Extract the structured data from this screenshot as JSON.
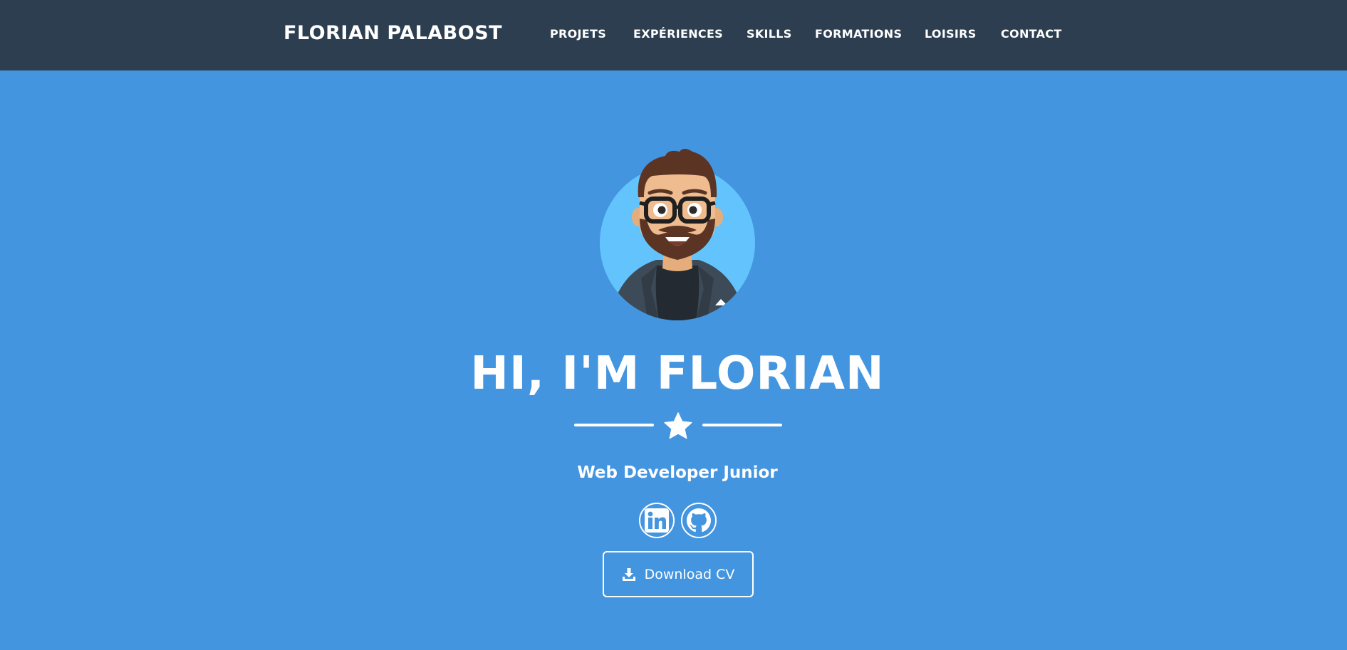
{
  "navbar": {
    "brand": "FLORIAN PALABOST",
    "items": [
      {
        "label": "PROJETS"
      },
      {
        "label": "EXPÉRIENCES"
      },
      {
        "label": "SKILLS"
      },
      {
        "label": "FORMATIONS"
      },
      {
        "label": "LOISIRS"
      },
      {
        "label": "CONTACT"
      }
    ]
  },
  "hero": {
    "avatar_icon": "bearded-man-with-glasses-avatar",
    "title": "HI, I'M FLORIAN",
    "divider_icon": "star-icon",
    "subtitle": "Web Developer Junior",
    "social": [
      {
        "icon": "linkedin-icon"
      },
      {
        "icon": "github-icon"
      }
    ],
    "cv_button": {
      "icon": "download-icon",
      "label": "Download CV"
    }
  },
  "colors": {
    "navbar_bg": "#2c3e50",
    "hero_bg": "#4495df",
    "text": "#ffffff",
    "avatar_circle": "#63c4fd"
  }
}
